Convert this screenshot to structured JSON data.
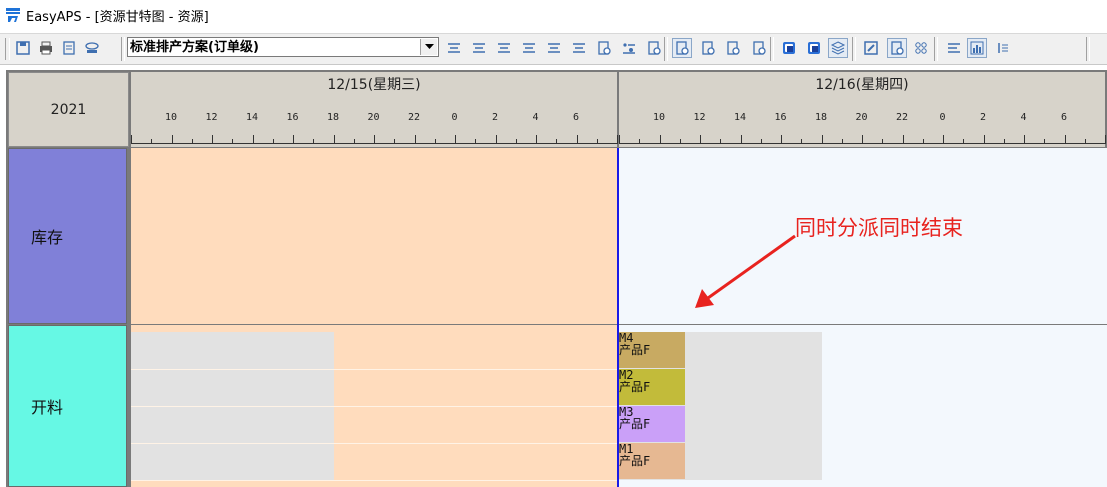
{
  "window": {
    "app_icon": "easyaps-logo-icon",
    "title": "EasyAPS - [资源甘特图 - 资源]"
  },
  "toolbar": {
    "plan_select_value": "标准排产方案(订单级)",
    "left_buttons": [
      {
        "name": "save-icon"
      },
      {
        "name": "print-icon"
      },
      {
        "name": "preview-icon"
      },
      {
        "name": "stamp-icon"
      }
    ],
    "right_buttons": [
      {
        "name": "schedule-icon"
      },
      {
        "name": "list-settings-icon"
      },
      {
        "name": "copy-doc-icon"
      },
      {
        "name": "indent-left-icon"
      },
      {
        "name": "filter-list-icon"
      },
      {
        "name": "align-right-icon"
      },
      {
        "name": "doc-lock-icon"
      },
      {
        "name": "dot-list-icon"
      },
      {
        "name": "refresh-doc-icon"
      },
      {
        "name": "view-mode-1-icon",
        "pressed": true
      },
      {
        "name": "view-mode-2-icon"
      },
      {
        "name": "view-mode-3-icon"
      },
      {
        "name": "view-mode-4-icon"
      },
      {
        "name": "blue-square-1-icon"
      },
      {
        "name": "blue-square-2-icon"
      },
      {
        "name": "layers-icon",
        "pressed": true
      },
      {
        "name": "edit-icon"
      },
      {
        "name": "report-icon",
        "pressed": true
      },
      {
        "name": "grid-icon"
      },
      {
        "name": "text-align-icon"
      },
      {
        "name": "chart-icon",
        "pressed": true
      },
      {
        "name": "more-icon"
      }
    ]
  },
  "gantt": {
    "year": "2021",
    "days": [
      {
        "label": "12/15(星期三)",
        "ticks": [
          "10",
          "12",
          "14",
          "16",
          "18",
          "20",
          "22",
          "0",
          "2",
          "4",
          "6"
        ]
      },
      {
        "label": "12/16(星期四)",
        "ticks": [
          "10",
          "12",
          "14",
          "16",
          "18",
          "20",
          "22",
          "0",
          "2",
          "4",
          "6"
        ]
      }
    ],
    "resources": [
      {
        "label": "库存",
        "color": "#8080d8"
      },
      {
        "label": "开料",
        "color": "#66f8e4"
      }
    ],
    "tasks": [
      {
        "code": "M4",
        "product": "产品F",
        "color": "#c8aa62"
      },
      {
        "code": "M2",
        "product": "产品F",
        "color": "#c2bb3a"
      },
      {
        "code": "M3",
        "product": "产品F",
        "color": "#caa0f8"
      },
      {
        "code": "M1",
        "product": "产品F",
        "color": "#e6b892"
      }
    ],
    "annotation": "同时分派同时结束"
  },
  "colors": {
    "past_bg": "#ffdcbd",
    "future_bg": "#f3f8fd",
    "current_time_line": "#1a1ae6",
    "annotation": "#e8231f"
  }
}
